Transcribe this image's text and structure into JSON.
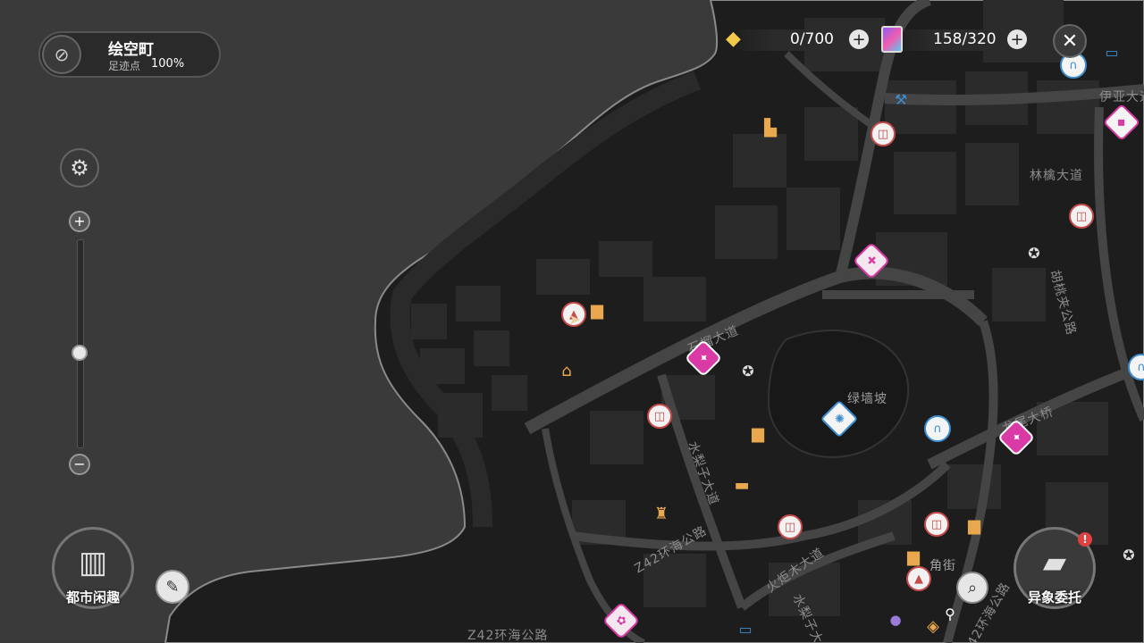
{
  "location": {
    "name": "绘空町",
    "progress_label": "足迹点",
    "progress_value": "100%"
  },
  "resources": {
    "energy": {
      "value": "0/700",
      "icon": "energy-crystal-icon"
    },
    "cards": {
      "value": "158/320",
      "icon": "card-pack-icon"
    }
  },
  "map_labels": [
    {
      "id": "yiya",
      "text": "伊亚大道"
    },
    {
      "id": "linqin",
      "text": "林檎大道"
    },
    {
      "id": "hutao",
      "text": "胡桃夹公路"
    },
    {
      "id": "shiliu",
      "text": "石榴大道"
    },
    {
      "id": "lvqiangpo",
      "text": "绿墙坡"
    },
    {
      "id": "longwei",
      "text": "龙尾大桥"
    },
    {
      "id": "shuili",
      "text": "水梨子大道"
    },
    {
      "id": "z42a",
      "text": "Z42环海公路"
    },
    {
      "id": "huoju",
      "text": "火炬木大道"
    },
    {
      "id": "shuili2",
      "text": "水梨子大道"
    },
    {
      "id": "jiaojie",
      "text": "角街"
    },
    {
      "id": "z42b",
      "text": "Z42环海公路"
    },
    {
      "id": "z42c",
      "text": "Z42环海公路"
    }
  ],
  "buttons": {
    "city_fun": "都市闲趣",
    "commission": "异象委托"
  },
  "colors": {
    "sea": "#3b3b3b",
    "land": "#1c1c1c",
    "road": "#404040",
    "poi_red": "#c84b4b",
    "poi_pink": "#d93aa6",
    "poi_orange": "#e9a84d",
    "poi_blue": "#3c8cd0",
    "notify": "#e04040"
  },
  "zoom_level": 0.45
}
